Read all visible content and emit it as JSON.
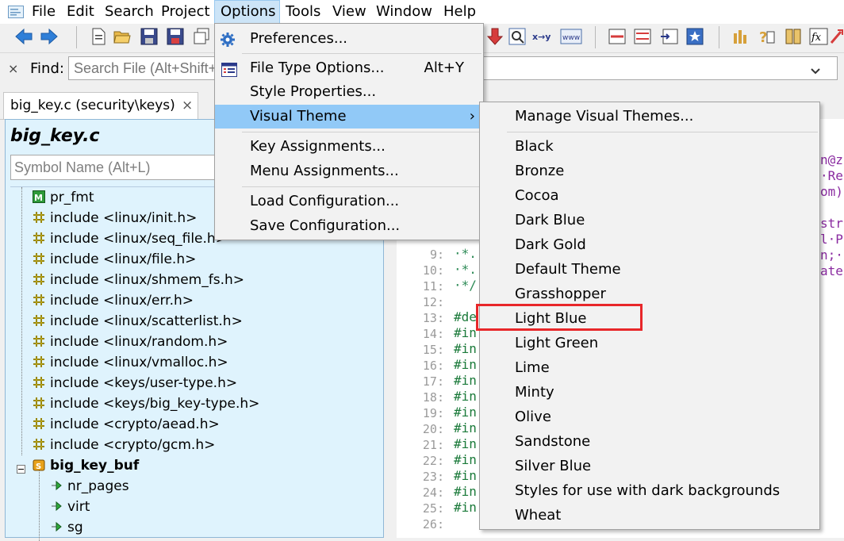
{
  "menubar": {
    "items": [
      "File",
      "Edit",
      "Search",
      "Project",
      "Options",
      "Tools",
      "View",
      "Window",
      "Help"
    ]
  },
  "findbar": {
    "label": "Find:",
    "placeholder": "Search File (Alt+Shift+F)"
  },
  "tab": {
    "title": "big_key.c (security\\keys)"
  },
  "symbols": {
    "title": "big_key.c",
    "placeholder": "Symbol Name (Alt+L)",
    "items": [
      {
        "label": "pr_fmt",
        "kind": "macro",
        "level": 0
      },
      {
        "label": "include <linux/init.h>",
        "kind": "include",
        "level": 0
      },
      {
        "label": "include <linux/seq_file.h>",
        "kind": "include",
        "level": 0
      },
      {
        "label": "include <linux/file.h>",
        "kind": "include",
        "level": 0
      },
      {
        "label": "include <linux/shmem_fs.h>",
        "kind": "include",
        "level": 0
      },
      {
        "label": "include <linux/err.h>",
        "kind": "include",
        "level": 0
      },
      {
        "label": "include <linux/scatterlist.h>",
        "kind": "include",
        "level": 0
      },
      {
        "label": "include <linux/random.h>",
        "kind": "include",
        "level": 0
      },
      {
        "label": "include <linux/vmalloc.h>",
        "kind": "include",
        "level": 0
      },
      {
        "label": "include <keys/user-type.h>",
        "kind": "include",
        "level": 0
      },
      {
        "label": "include <keys/big_key-type.h>",
        "kind": "include",
        "level": 0
      },
      {
        "label": "include <crypto/aead.h>",
        "kind": "include",
        "level": 0
      },
      {
        "label": "include <crypto/gcm.h>",
        "kind": "include",
        "level": 0
      },
      {
        "label": "big_key_buf",
        "kind": "struct",
        "level": 0
      },
      {
        "label": "nr_pages",
        "kind": "member",
        "level": 1
      },
      {
        "label": "virt",
        "kind": "member",
        "level": 1
      },
      {
        "label": "sg",
        "kind": "member",
        "level": 1
      }
    ]
  },
  "editor": {
    "line_numbers": [
      "9:",
      "10:",
      "11:",
      "12:",
      "13:",
      "14:",
      "15:",
      "16:",
      "17:",
      "18:",
      "19:",
      "20:",
      "21:",
      "22:",
      "23:",
      "24:",
      "25:",
      "26:"
    ],
    "code_lines": [
      "·*.",
      "·*.",
      "·*/",
      "",
      "#de",
      "#in",
      "#in",
      "#in",
      "#in",
      "#in",
      "#in",
      "#in",
      "#in",
      "#in",
      "#in",
      "#in",
      "#in",
      ""
    ],
    "right_fragments": [
      "n@z",
      "·Re",
      "om)",
      "str",
      "l·P",
      "n;·",
      "ate"
    ]
  },
  "options_menu": {
    "items": [
      {
        "label": "Preferences...",
        "accel": "",
        "icon": "gear-icon"
      },
      {
        "label": "File Type Options...",
        "accel": "Alt+Y",
        "icon": "file-type-icon"
      },
      {
        "label": "Style Properties...",
        "accel": ""
      },
      {
        "label": "Visual Theme",
        "accel": "›"
      },
      {
        "label": "Key Assignments...",
        "accel": ""
      },
      {
        "label": "Menu Assignments...",
        "accel": ""
      },
      {
        "label": "Load Configuration...",
        "accel": ""
      },
      {
        "label": "Save Configuration...",
        "accel": ""
      }
    ]
  },
  "theme_menu": {
    "manage": "Manage Visual Themes...",
    "themes": [
      "Black",
      "Bronze",
      "Cocoa",
      "Dark Blue",
      "Dark Gold",
      "Default Theme",
      "Grasshopper",
      "Light Blue",
      "Light Green",
      "Lime",
      "Minty",
      "Olive",
      "Sandstone",
      "Silver Blue",
      "Styles for use with dark backgrounds",
      "Wheat"
    ],
    "highlighted": "Light Blue"
  },
  "colors": {
    "menu_highlight": "#91c9f7",
    "panel_bg": "#dff3fd",
    "callout_red": "#e8272a",
    "code_green": "#2e8b57",
    "code_purple": "#8a2ba0"
  }
}
